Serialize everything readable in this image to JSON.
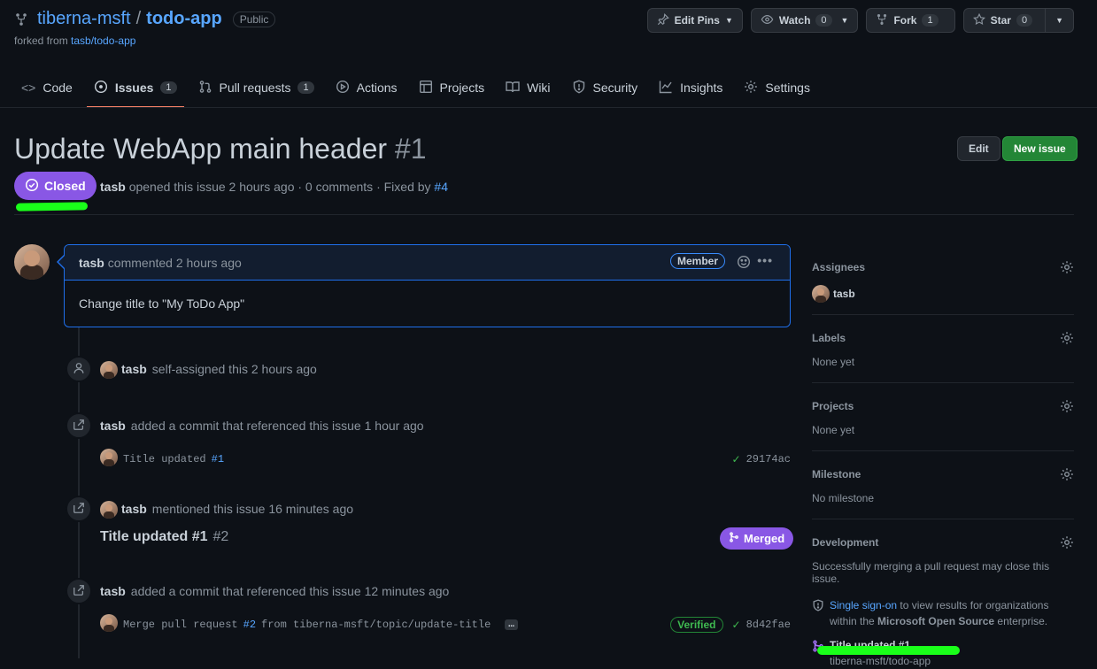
{
  "repo": {
    "owner": "tiberna-msft",
    "separator": "/",
    "name": "todo-app",
    "visibility": "Public",
    "forked_prefix": "forked from",
    "forked_from": "tasb/todo-app"
  },
  "actions": {
    "edit_pins": "Edit Pins",
    "watch": "Watch",
    "watch_count": "0",
    "fork": "Fork",
    "fork_count": "1",
    "star": "Star",
    "star_count": "0"
  },
  "tabs": [
    {
      "label": "Code"
    },
    {
      "label": "Issues",
      "count": "1"
    },
    {
      "label": "Pull requests",
      "count": "1"
    },
    {
      "label": "Actions"
    },
    {
      "label": "Projects"
    },
    {
      "label": "Wiki"
    },
    {
      "label": "Security"
    },
    {
      "label": "Insights"
    },
    {
      "label": "Settings"
    }
  ],
  "issue": {
    "title": "Update WebApp main header",
    "number": "#1",
    "edit": "Edit",
    "new_issue": "New issue",
    "state": "Closed",
    "author": "tasb",
    "meta_text": "opened this issue 2 hours ago · 0 comments · Fixed by",
    "fixed_by": "#4"
  },
  "comment": {
    "author": "tasb",
    "time": "commented 2 hours ago",
    "role": "Member",
    "body": "Change title to \"My ToDo App\""
  },
  "timeline": {
    "assigned": {
      "user": "tasb",
      "text": "self-assigned this 2 hours ago"
    },
    "commit1": {
      "user": "tasb",
      "text": "added a commit that referenced this issue 1 hour ago",
      "message": "Title updated",
      "ref": "#1",
      "sha": "29174ac"
    },
    "mention": {
      "user": "tasb",
      "text": "mentioned this issue 16 minutes ago",
      "pr_title": "Title updated #1",
      "pr_number": "#2",
      "status": "Merged"
    },
    "commit2": {
      "user": "tasb",
      "text": "added a commit that referenced this issue 12 minutes ago",
      "message_a": "Merge pull request",
      "ref": "#2",
      "message_b": "from tiberna-msft/topic/update-title",
      "ellipsis": "…",
      "verified": "Verified",
      "sha": "8d42fae"
    }
  },
  "sidebar": {
    "assignees": {
      "heading": "Assignees",
      "user": "tasb"
    },
    "labels": {
      "heading": "Labels",
      "value": "None yet"
    },
    "projects": {
      "heading": "Projects",
      "value": "None yet"
    },
    "milestone": {
      "heading": "Milestone",
      "value": "No milestone"
    },
    "development": {
      "heading": "Development",
      "note": "Successfully merging a pull request may close this issue.",
      "sso_link": "Single sign-on",
      "sso_text_a": "to view results for organizations",
      "sso_text_b": "within the",
      "sso_org": "Microsoft Open Source",
      "sso_text_c": "enterprise.",
      "pr_title": "Title updated #1",
      "pr_repo": "tiberna-msft/todo-app"
    }
  },
  "colors": {
    "accent": "#58a6ff",
    "closed": "#8957e5",
    "new_issue": "#238636",
    "highlight": "#1aff1a",
    "tab_underline": "#f78166"
  }
}
